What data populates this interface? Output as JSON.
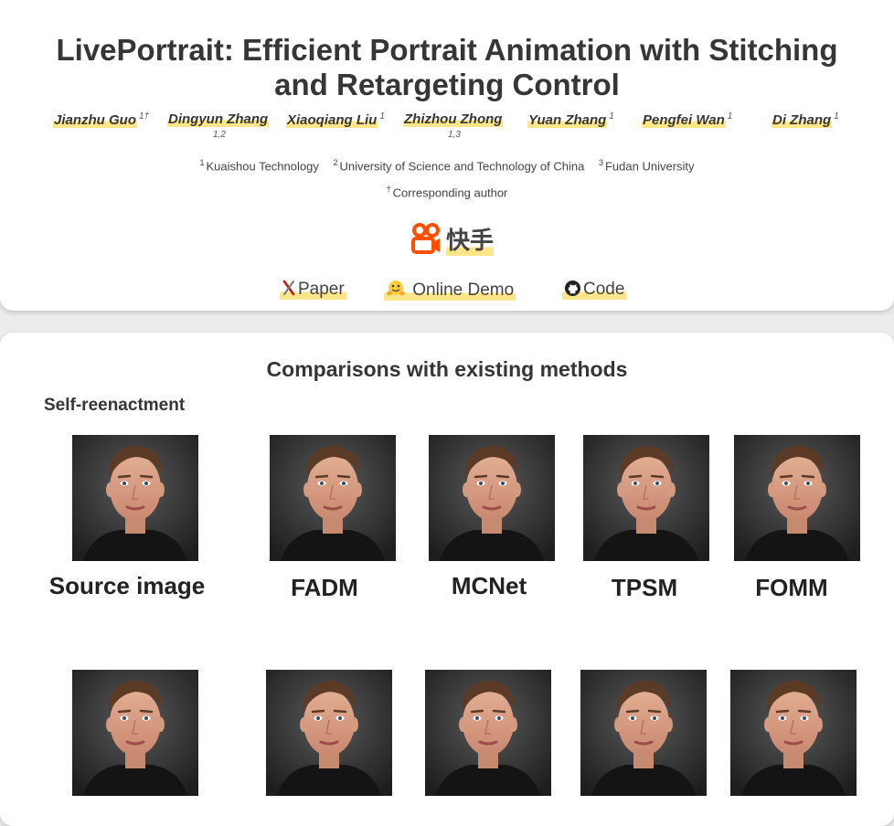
{
  "header": {
    "title_line1": "LivePortrait: Efficient Portrait Animation with Stitching",
    "title_line2": "and Retargeting Control",
    "authors": [
      {
        "name": "Jianzhu Guo",
        "sup": "1†",
        "sub": ""
      },
      {
        "name": "Dingyun Zhang",
        "sup": "",
        "sub": "1,2"
      },
      {
        "name": "Xiaoqiang Liu",
        "sup": "1",
        "sub": ""
      },
      {
        "name": "Zhizhou Zhong",
        "sup": "",
        "sub": "1,3"
      },
      {
        "name": "Yuan Zhang",
        "sup": "1",
        "sub": ""
      },
      {
        "name": "Pengfei Wan",
        "sup": "1",
        "sub": ""
      },
      {
        "name": "Di Zhang",
        "sup": "1",
        "sub": ""
      }
    ],
    "affiliations": [
      {
        "num": "1",
        "name": "Kuaishou Technology"
      },
      {
        "num": "2",
        "name": "University of Science and Technology of China"
      },
      {
        "num": "3",
        "name": "Fudan University"
      }
    ],
    "corresponding_mark": "†",
    "corresponding_text": "Corresponding author",
    "logo_text": "快手",
    "links": [
      {
        "label": "Paper",
        "icon": "arxiv-icon"
      },
      {
        "label": "Online Demo",
        "icon": "hugging-face-icon"
      },
      {
        "label": "Code",
        "icon": "github-icon"
      }
    ]
  },
  "comparisons": {
    "section_title": "Comparisons with existing methods",
    "subsection_title": "Self-reenactment",
    "row1_captions": [
      "Source image",
      "FADM",
      "MCNet",
      "TPSM",
      "FOMM"
    ]
  },
  "colors": {
    "highlight": "#fde68a",
    "text": "#363636",
    "kuaishou_orange": "#ff5000"
  }
}
